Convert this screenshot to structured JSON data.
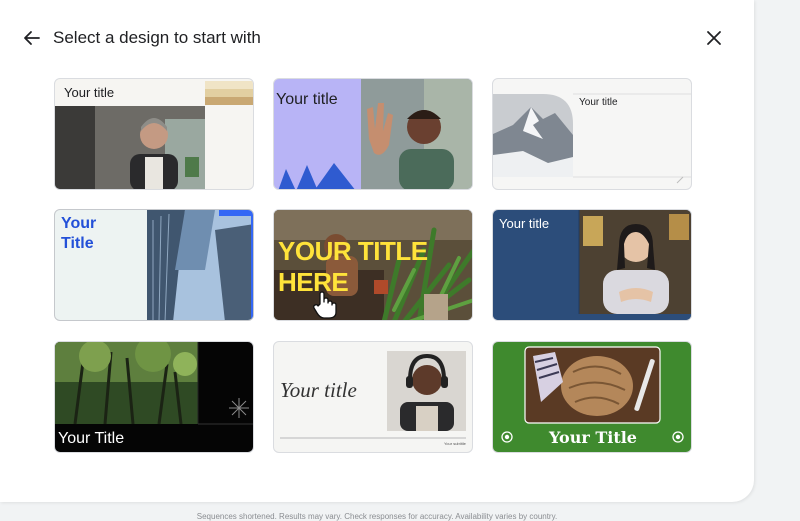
{
  "header": {
    "title": "Select a design to start with"
  },
  "templates": [
    {
      "title": "Your title"
    },
    {
      "title": "Your title"
    },
    {
      "title": "Your title"
    },
    {
      "title": "Your Title"
    },
    {
      "title": "YOUR TITLE HERE"
    },
    {
      "title": "Your title"
    },
    {
      "title": "Your Title"
    },
    {
      "title": "Your title",
      "subtitle": "Your subtitle"
    },
    {
      "title": "Your Title"
    }
  ],
  "footer": {
    "note": "Sequences shortened. Results may vary. Check responses for accuracy. Availability varies by country."
  },
  "colors": {
    "accent_blue": "#3367f5",
    "deep_blue": "#2c4d7a",
    "green": "#3f8a2e",
    "lavender": "#b8b4f6",
    "yellow_text": "#ffe33a"
  }
}
